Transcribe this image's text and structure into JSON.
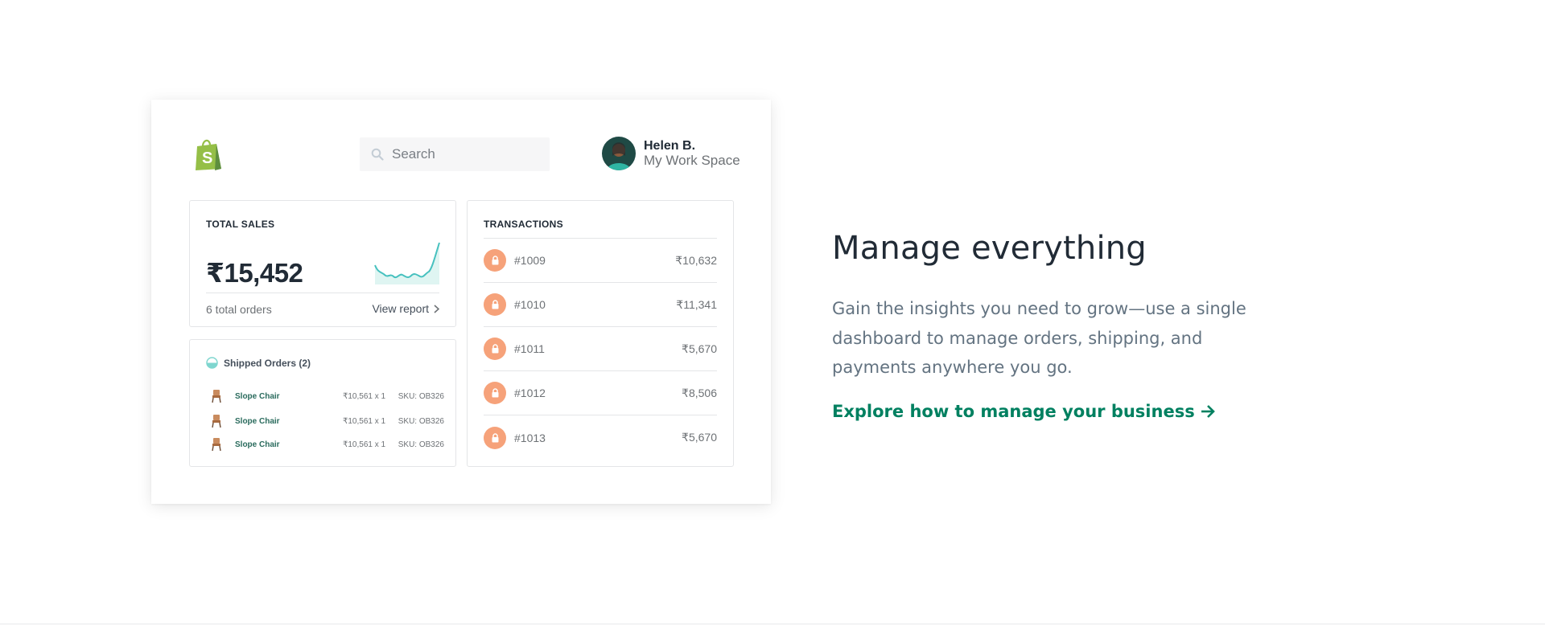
{
  "dashboard": {
    "search": {
      "placeholder": "Search"
    },
    "user": {
      "name": "Helen B.",
      "workspace": "My Work Space"
    },
    "total_sales": {
      "title": "TOTAL SALES",
      "value": "₹15,452",
      "orders": "6 total orders",
      "view_report": "View report"
    },
    "shipped": {
      "title": "Shipped Orders (2)",
      "items": [
        {
          "name": "Slope Chair",
          "price": "₹10,561 x 1",
          "sku": "SKU: OB326"
        },
        {
          "name": "Slope Chair",
          "price": "₹10,561 x 1",
          "sku": "SKU: OB326"
        },
        {
          "name": "Slope Chair",
          "price": "₹10,561 x 1",
          "sku": "SKU: OB326"
        }
      ]
    },
    "transactions": {
      "title": "TRANSACTIONS",
      "rows": [
        {
          "id": "#1009",
          "amount": "₹10,632"
        },
        {
          "id": "#1010",
          "amount": "₹11,341"
        },
        {
          "id": "#1011",
          "amount": "₹5,670"
        },
        {
          "id": "#1012",
          "amount": "₹8,506"
        },
        {
          "id": "#1013",
          "amount": "₹5,670"
        }
      ]
    }
  },
  "content": {
    "headline": "Manage everything",
    "description": "Gain the insights you need to grow—use a single dashboard to manage orders, shipping, and payments anywhere you go.",
    "cta": "Explore how to manage your business"
  },
  "colors": {
    "brand_green": "#95bf47",
    "cta_green": "#008060",
    "lock_badge": "#f6a27a",
    "sparkline": "#47c1bf"
  },
  "icons": [
    "shopify-bag-icon",
    "search-icon",
    "avatar",
    "chevron-right-icon",
    "half-circle-icon",
    "chair-icon",
    "lock-icon",
    "arrow-right-icon"
  ]
}
